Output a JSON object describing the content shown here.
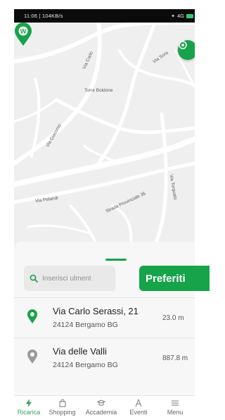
{
  "status_bar": {
    "time_info": "11:06 | 104KB/s",
    "signal_text": "4G"
  },
  "map": {
    "place_label": "Torre Boldone",
    "street_labels": [
      "Via Carlo",
      "Via Sora",
      "Via Giacomo",
      "Via Pelandi",
      "Strada Provinciale 35",
      "Via Torquato"
    ],
    "pin_letter": "W"
  },
  "search": {
    "placeholder": "Inserisci ulment"
  },
  "favorites_button": {
    "label": "Preferiti"
  },
  "results": [
    {
      "street": "Via Carlo Serassi, 21",
      "city": "24124 Bergamo BG",
      "distance": "23.0 m"
    },
    {
      "street": "Via delle Valli",
      "city": "24124 Bergamo BG",
      "distance": "887.8 m"
    }
  ],
  "tabs": [
    {
      "label": "Ricarica",
      "icon": "bolt-icon",
      "active": true
    },
    {
      "label": "Shopping",
      "icon": "bag-icon"
    },
    {
      "label": "Accademia",
      "icon": "cap-icon"
    },
    {
      "label": "Eventi",
      "icon": "event-icon"
    },
    {
      "label": "Menu",
      "icon": "menu-icon"
    }
  ],
  "colors": {
    "accent": "#16a34a",
    "map_bg": "#efefef",
    "road": "#ffffff"
  }
}
